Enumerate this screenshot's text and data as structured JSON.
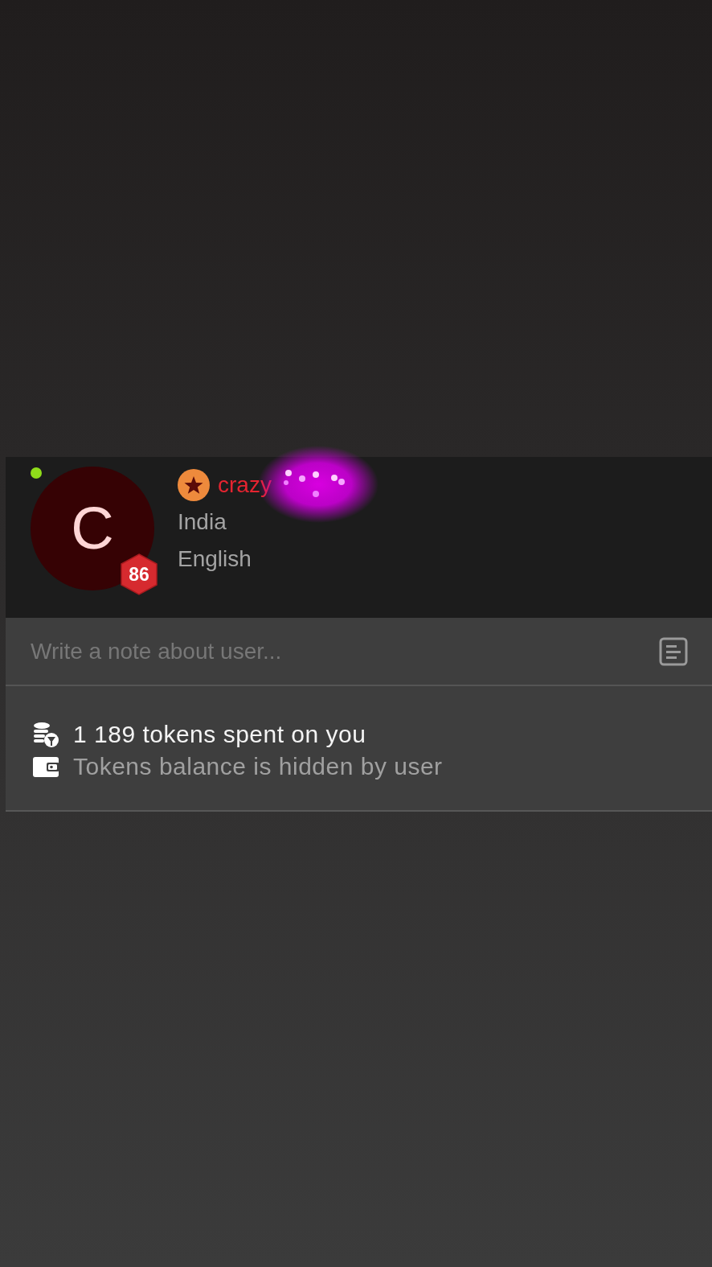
{
  "profile": {
    "online": true,
    "avatar_letter": "C",
    "level_badge": "86",
    "username": "crazy",
    "country": "India",
    "language": "English"
  },
  "note_field": {
    "placeholder": "Write a note about user..."
  },
  "tokens": {
    "spent": "1 189 tokens spent on you",
    "balance": "Tokens balance is hidden by user"
  }
}
